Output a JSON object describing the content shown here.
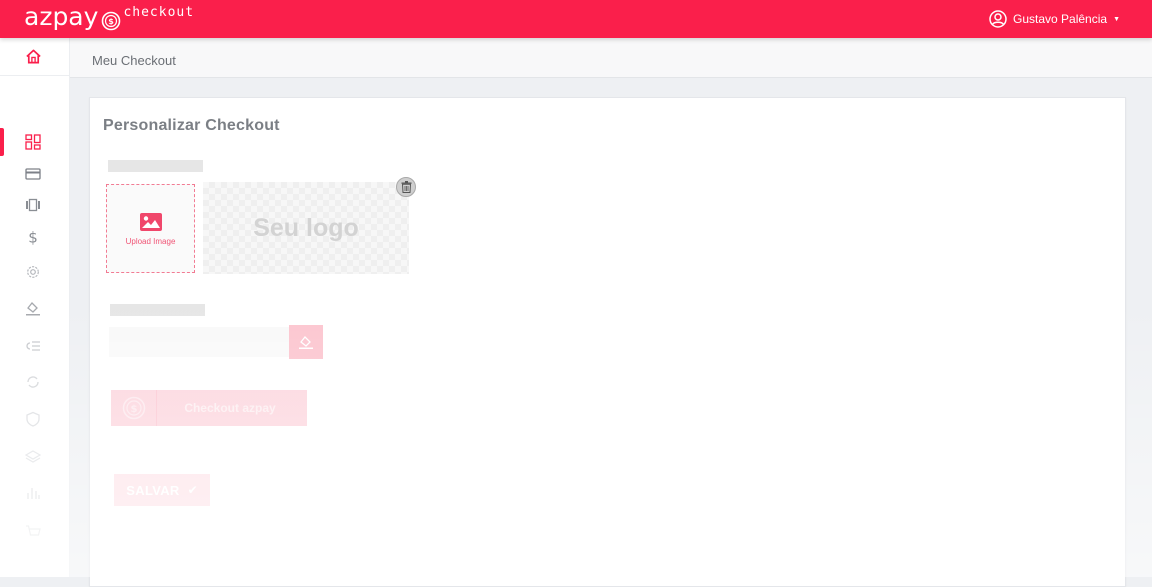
{
  "brand": {
    "name": "azpay",
    "product": "checkout",
    "color": "#fa1f4b"
  },
  "header": {
    "user_name": "Gustavo Palência",
    "user_icon": "user-circle-icon",
    "caret_icon": "caret-down-icon"
  },
  "sidebar": {
    "home_icon": "home-icon",
    "items": [
      {
        "icon": "dashboard-icon",
        "active": true
      },
      {
        "icon": "credit-card-icon",
        "active": false
      },
      {
        "icon": "carousel-icon",
        "active": false
      },
      {
        "icon": "dollar-icon",
        "active": false
      },
      {
        "icon": "gear-icon",
        "active": false
      },
      {
        "icon": "paint-bucket-icon",
        "active": false
      },
      {
        "icon": "list-check-icon",
        "active": false
      },
      {
        "icon": "refresh-icon",
        "active": false
      },
      {
        "icon": "shield-icon",
        "active": false
      },
      {
        "icon": "layers-icon",
        "active": false
      },
      {
        "icon": "bar-chart-icon",
        "active": false
      },
      {
        "icon": "cart-icon",
        "active": false
      }
    ]
  },
  "breadcrumb": {
    "current": "Meu Checkout"
  },
  "main": {
    "title": "Personalizar Checkout",
    "upload": {
      "label": "Upload Image",
      "icon": "image-icon"
    },
    "logo_preview": {
      "text": "Seu logo",
      "delete_icon": "trash-icon"
    },
    "color_picker": {
      "value": "",
      "icon": "paint-bucket-icon"
    },
    "checkout_button": {
      "label": "Checkout azpay",
      "icon": "azpay-coin-icon"
    },
    "save_button": {
      "label": "SALVAR",
      "icon": "check-icon"
    }
  }
}
